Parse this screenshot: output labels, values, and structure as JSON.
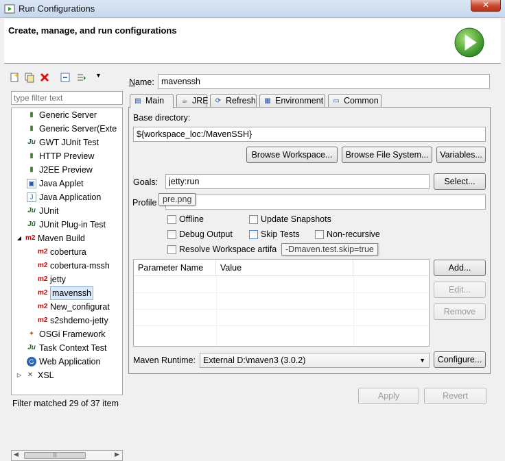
{
  "window": {
    "title": "Run Configurations",
    "close_glyph": "✕"
  },
  "banner": {
    "title": "Create, manage, and run configurations",
    "icon": "run-icon"
  },
  "left": {
    "toolbar_icons": [
      "new-launch-configuration-icon",
      "duplicate-icon",
      "delete-icon",
      "collapse-all-icon",
      "filter-icon",
      "view-menu-icon"
    ],
    "filter_placeholder": "type filter text",
    "tree": [
      {
        "label": "Generic Server",
        "icon": "server-icon",
        "level": 1
      },
      {
        "label": "Generic Server(Exte",
        "icon": "server-icon",
        "level": 1
      },
      {
        "label": "GWT JUnit Test",
        "icon": "junit-icon",
        "level": 1
      },
      {
        "label": "HTTP Preview",
        "icon": "server-icon",
        "level": 1
      },
      {
        "label": "J2EE Preview",
        "icon": "server-icon",
        "level": 1
      },
      {
        "label": "Java Applet",
        "icon": "applet-icon",
        "level": 1
      },
      {
        "label": "Java Application",
        "icon": "java-app-icon",
        "level": 1
      },
      {
        "label": "JUnit",
        "icon": "junit-icon",
        "level": 1
      },
      {
        "label": "JUnit Plug-in Test",
        "icon": "junit-plugin-icon",
        "level": 1
      },
      {
        "label": "Maven Build",
        "icon": "maven-icon",
        "level": 0,
        "expanded": true
      },
      {
        "label": "cobertura",
        "icon": "maven-icon",
        "level": 2
      },
      {
        "label": "cobertura-mssh",
        "icon": "maven-icon",
        "level": 2
      },
      {
        "label": "jetty",
        "icon": "maven-icon",
        "level": 2
      },
      {
        "label": "mavenssh",
        "icon": "maven-icon",
        "level": 2,
        "selected": true
      },
      {
        "label": "New_configurat",
        "icon": "maven-icon",
        "level": 2
      },
      {
        "label": "s2shdemo-jetty",
        "icon": "maven-icon",
        "level": 2
      },
      {
        "label": "OSGi Framework",
        "icon": "osgi-icon",
        "level": 1
      },
      {
        "label": "Task Context Test",
        "icon": "junit-icon",
        "level": 1
      },
      {
        "label": "Web Application",
        "icon": "web-app-icon",
        "level": 1
      },
      {
        "label": "XSL",
        "icon": "xsl-icon",
        "level": 0,
        "expanded": false
      }
    ],
    "status": "Filter matched 29 of 37 item"
  },
  "config": {
    "name_label": "Name:",
    "name_value": "mavenssh",
    "tabs": [
      {
        "label": "Main",
        "icon": "main-tab-icon",
        "active": true
      },
      {
        "label": "JRE",
        "icon": "jre-icon"
      },
      {
        "label": "Refresh",
        "icon": "refresh-icon"
      },
      {
        "label": "Environment",
        "icon": "environment-icon"
      },
      {
        "label": "Common",
        "icon": "common-icon"
      }
    ],
    "base_dir_label": "Base directory:",
    "base_dir_value": "${workspace_loc:/MavenSSH}",
    "browse_workspace": "Browse Workspace...",
    "browse_fs": "Browse File System...",
    "variables": "Variables...",
    "goals_label": "Goals:",
    "goals_value": "jetty:run",
    "select": "Select...",
    "profiles_label": "Profile",
    "tooltip_profiles": "pre.png",
    "checkboxes": {
      "offline": "Offline",
      "update_snapshots": "Update Snapshots",
      "debug_output": "Debug Output",
      "skip_tests": "Skip Tests",
      "non_recursive": "Non-recursive",
      "resolve_workspace": "Resolve Workspace artifa"
    },
    "tooltip_skip": "-Dmaven.test.skip=true",
    "table": {
      "col_name": "Parameter Name",
      "col_value": "Value"
    },
    "add": "Add...",
    "edit": "Edit...",
    "remove": "Remove",
    "runtime_label": "Maven Runtime:",
    "runtime_value": "External D:\\maven3 (3.0.2)",
    "configure": "Configure...",
    "apply": "Apply",
    "revert": "Revert"
  },
  "colors": {
    "maven_red": "#cc0000",
    "selection": "#dbe9f8",
    "run_green": "#3aa32a"
  }
}
